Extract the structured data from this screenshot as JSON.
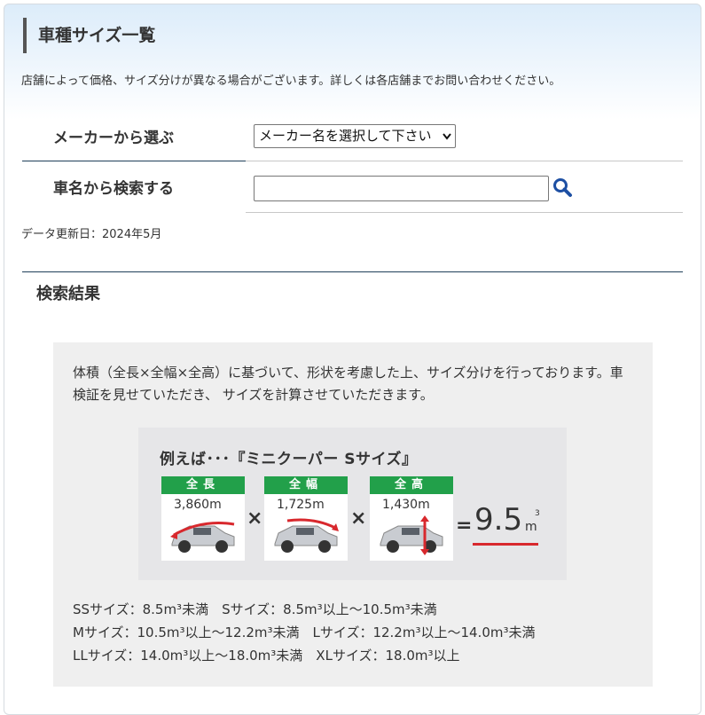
{
  "page": {
    "title": "車種サイズ一覧",
    "note": "店舗によって価格、サイズ分けが異なる場合がございます。詳しくは各店舗までお問い合わせください。"
  },
  "maker": {
    "label": "メーカーから選ぶ",
    "select_value": "メーカー名を選択して下さい"
  },
  "car_name": {
    "label": "車名から検索する",
    "input_value": "",
    "button_icon": "search-icon"
  },
  "updated": "データ更新日：2024年5月",
  "results": {
    "title": "検索結果",
    "description": "体積（全長×全幅×全高）に基づいて、形状を考慮した上、サイズ分けを行っております。車検証を見せていただき、 サイズを計算させていただきます。",
    "example": {
      "title": "例えば･･･『ミニクーパー Sサイズ』",
      "cards": [
        {
          "label": "全長",
          "value": "3,860m"
        },
        {
          "label": "全幅",
          "value": "1,725m"
        },
        {
          "label": "全高",
          "value": "1,430m"
        }
      ],
      "times": "×",
      "equals": "=",
      "result": "9.5",
      "result_unit": "m",
      "result_sup": "3"
    },
    "sizes": [
      "SSサイズ：8.5m³未満　Sサイズ：8.5m³以上～10.5m³未満",
      "Mサイズ：10.5m³以上～12.2m³未満　Lサイズ：12.2m³以上～14.0m³未満",
      "LLサイズ：14.0m³以上～18.0m³未満　XLサイズ：18.0m³以上"
    ]
  },
  "colors": {
    "accent_green": "#22a04a",
    "underline_red": "#d8282d",
    "search_blue": "#1d4fa3"
  }
}
